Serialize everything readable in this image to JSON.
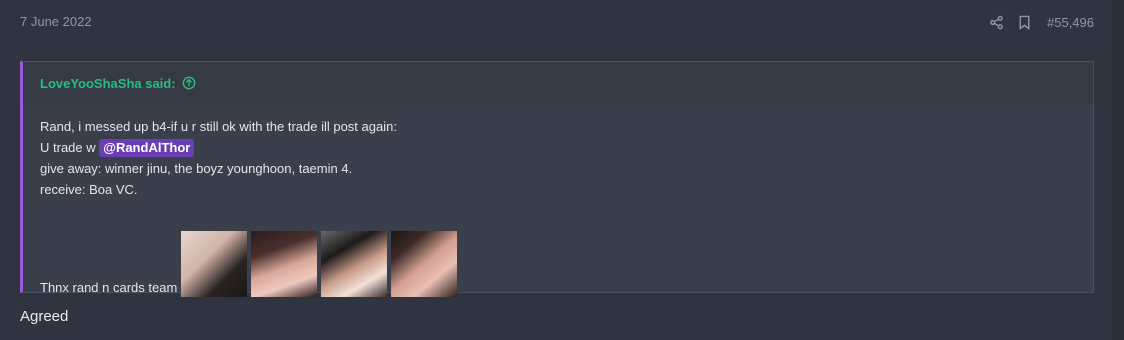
{
  "post": {
    "date": "7 June 2022",
    "number": "#55,496",
    "reply": "Agreed"
  },
  "quote": {
    "author": "LoveYooShaSha said:",
    "line1": "Rand, i messed up b4-if u r still ok with the trade ill post again:",
    "line2_prefix": "U trade w",
    "mention": "@RandAlThor",
    "line3": "give away: winner jinu, the boyz younghoon, taemin 4.",
    "line4": "receive: Boa VC.",
    "thanks": "Thnx rand n cards team"
  },
  "icons": {
    "share": "share-icon",
    "bookmark": "bookmark-icon",
    "quote_link": "arrow-up-circle-icon"
  },
  "colors": {
    "background": "#2f3440",
    "quote_bg": "#3a3f4b",
    "quote_accent": "#9b59d6",
    "author": "#2bbd7e",
    "mention_bg": "#6a3fb5"
  }
}
